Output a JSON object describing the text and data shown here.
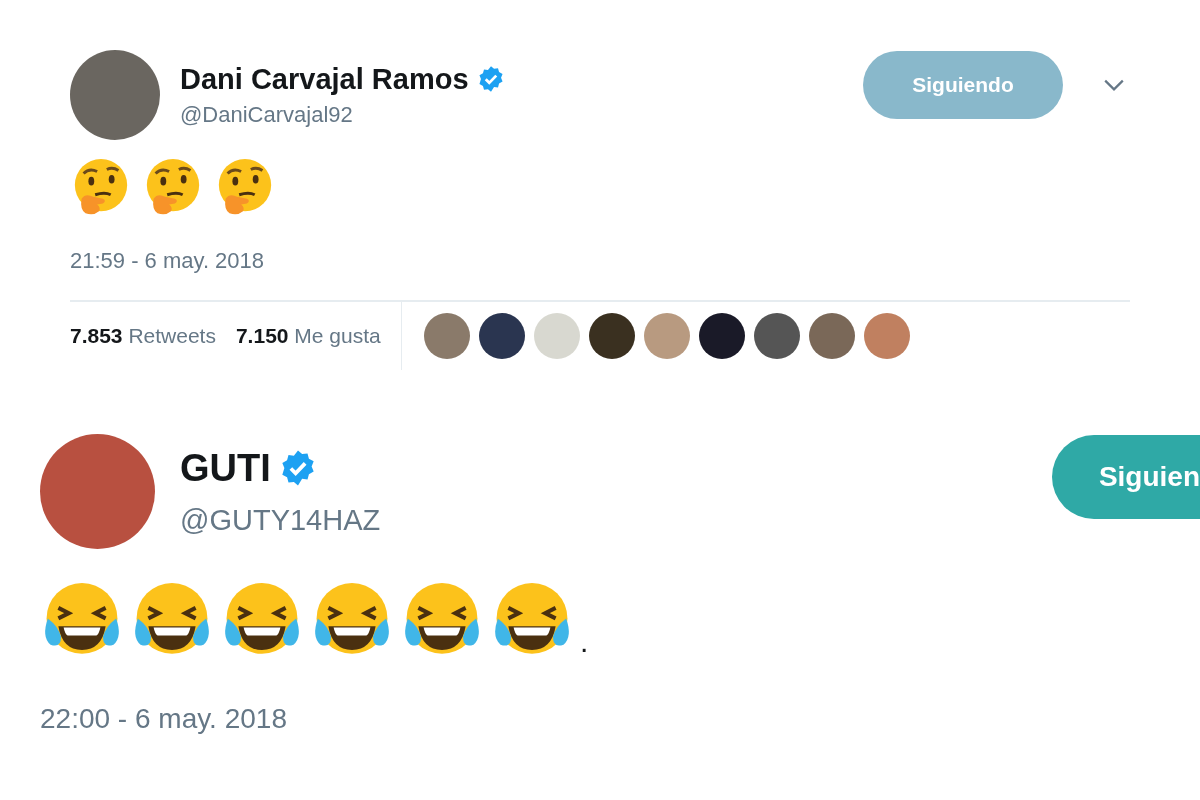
{
  "tweets": [
    {
      "author": {
        "name": "Dani Carvajal Ramos",
        "handle": "@DaniCarvajal92",
        "verified": true
      },
      "follow_button": {
        "label": "Siguiendo"
      },
      "menu_caret": true,
      "emojis": [
        {
          "kind": "thinking"
        },
        {
          "kind": "thinking"
        },
        {
          "kind": "thinking"
        }
      ],
      "time": "21:59 - 6 may. 2018",
      "stats": [
        {
          "count": "7.853",
          "label": "Retweets"
        },
        {
          "count": "7.150",
          "label": "Me gusta"
        }
      ]
    },
    {
      "author": {
        "name": "GUTI",
        "handle": "@GUTY14HAZ",
        "verified": true
      },
      "follow_button": {
        "label": "Siguien"
      },
      "emojis": [
        {
          "kind": "laughing"
        },
        {
          "kind": "laughing"
        },
        {
          "kind": "laughing"
        },
        {
          "kind": "laughing"
        },
        {
          "kind": "laughing"
        },
        {
          "kind": "laughing"
        }
      ],
      "text_after": ".",
      "time": "22:00 - 6 may. 2018"
    }
  ]
}
